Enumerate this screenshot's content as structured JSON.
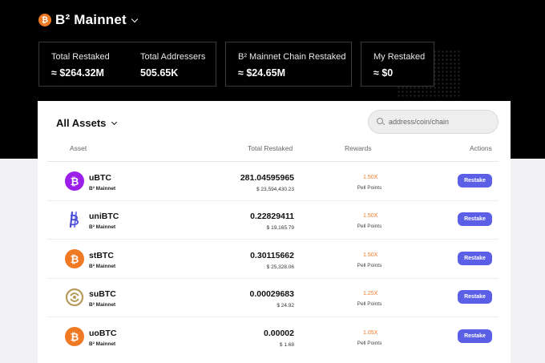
{
  "header": {
    "network_label": "B² Mainnet",
    "logo_glyph": "₿"
  },
  "stats": [
    {
      "label": "Total Restaked",
      "value": "≈ $264.32M"
    },
    {
      "label": "Total Addressers",
      "value": "505.65K"
    },
    {
      "label": "B² Mainnet Chain Restaked",
      "value": "≈ $24.65M"
    },
    {
      "label": "My Restaked",
      "value": "≈ $0"
    }
  ],
  "assets_panel": {
    "title": "All Assets",
    "search_placeholder": "address/coin/chain",
    "columns": {
      "asset": "Asset",
      "total_restaked": "Total Restaked",
      "rewards": "Rewards",
      "actions": "Actions"
    },
    "rows": [
      {
        "symbol": "uBTC",
        "network": "B² Mainnet",
        "amount": "281.04595965",
        "usd": "$ 23,594,430.23",
        "reward": "1.50X",
        "reward_label": "Pell Points",
        "action": "Restake",
        "icon": "ubtc-icon",
        "color": "#9b1fe8"
      },
      {
        "symbol": "uniBTC",
        "network": "B² Mainnet",
        "amount": "0.22829411",
        "usd": "$ 19,165.79",
        "reward": "1.50X",
        "reward_label": "Pell Points",
        "action": "Restake",
        "icon": "unibtc-icon",
        "color": "#4b4ed6"
      },
      {
        "symbol": "stBTC",
        "network": "B² Mainnet",
        "amount": "0.30115662",
        "usd": "$ 25,328.06",
        "reward": "1.50X",
        "reward_label": "Pell Points",
        "action": "Restake",
        "icon": "stbtc-icon",
        "color": "#f07a24"
      },
      {
        "symbol": "suBTC",
        "network": "B² Mainnet",
        "amount": "0.00029683",
        "usd": "$ 24.92",
        "reward": "1.25X",
        "reward_label": "Pell Points",
        "action": "Restake",
        "icon": "subtc-icon",
        "color": "#b89a5a"
      },
      {
        "symbol": "uoBTC",
        "network": "B² Mainnet",
        "amount": "0.00002",
        "usd": "$ 1.68",
        "reward": "1.05X",
        "reward_label": "Pell Points",
        "action": "Restake",
        "icon": "uobtc-icon",
        "color": "#f07a24"
      }
    ]
  }
}
